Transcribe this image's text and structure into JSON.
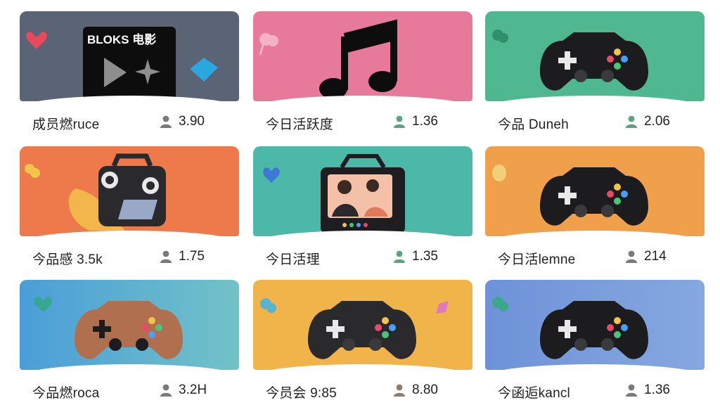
{
  "cards": [
    {
      "title": "成员燃ruce",
      "stat": "3.90",
      "bg": "#5a6474",
      "icon": "film-player-icon",
      "decor": [
        "heart-icon",
        "gem-icon"
      ],
      "badge": "BLOKS 电影",
      "accent": "#e74b5b",
      "person_color": "#7a7a7a"
    },
    {
      "title": "今日活跃度",
      "stat": "1.36",
      "bg": "#e77a9a",
      "icon": "music-note-icon",
      "decor": [
        "pin-icon"
      ],
      "accent": "#f0a0b8",
      "person_color": "#5aa67c"
    },
    {
      "title": "今品 Duneh",
      "stat": "2.06",
      "bg": "#4fb890",
      "icon": "gamepad-icon",
      "decor": [
        "pin-icon"
      ],
      "accent": "#3a9a78",
      "person_color": "#5aa67c"
    },
    {
      "title": "今品感 3.5k",
      "stat": "1.75",
      "bg": "#ee7a4c",
      "icon": "radio-icon",
      "decor": [
        "pin-icon"
      ],
      "accent": "#f2c64a",
      "person_color": "#7a7a7a"
    },
    {
      "title": "今日活理",
      "stat": "1.35",
      "bg": "#4bb8a8",
      "icon": "tv-icon",
      "decor": [
        "heart-icon"
      ],
      "accent": "#3e78d6",
      "person_color": "#5aa67c"
    },
    {
      "title": "今日活lemne",
      "stat": "214",
      "bg": "#f0a04a",
      "icon": "gamepad-icon",
      "decor": [
        "pin-icon"
      ],
      "accent": "#f2c86a",
      "person_color": "#7a7a7a"
    },
    {
      "title": "今品燃roca",
      "stat": "3.2H",
      "bg": "#5aa6d8",
      "icon": "gamepad-brown-icon",
      "decor": [
        "heart-icon"
      ],
      "accent": "#35a890",
      "person_color": "#7a7a7a"
    },
    {
      "title": "今员会 9:85",
      "stat": "8.80",
      "bg": "#f0b44a",
      "icon": "gamepad-icon",
      "decor": [
        "pin-icon",
        "gem-icon"
      ],
      "accent": "#5ab4d0",
      "person_color": "#8c8068"
    },
    {
      "title": "今函逅kancl",
      "stat": "1.36",
      "bg": "#6e92d8",
      "icon": "gamepad-icon",
      "decor": [
        "pin-icon"
      ],
      "accent": "#3aa88a",
      "person_color": "#7a7a7a"
    }
  ]
}
